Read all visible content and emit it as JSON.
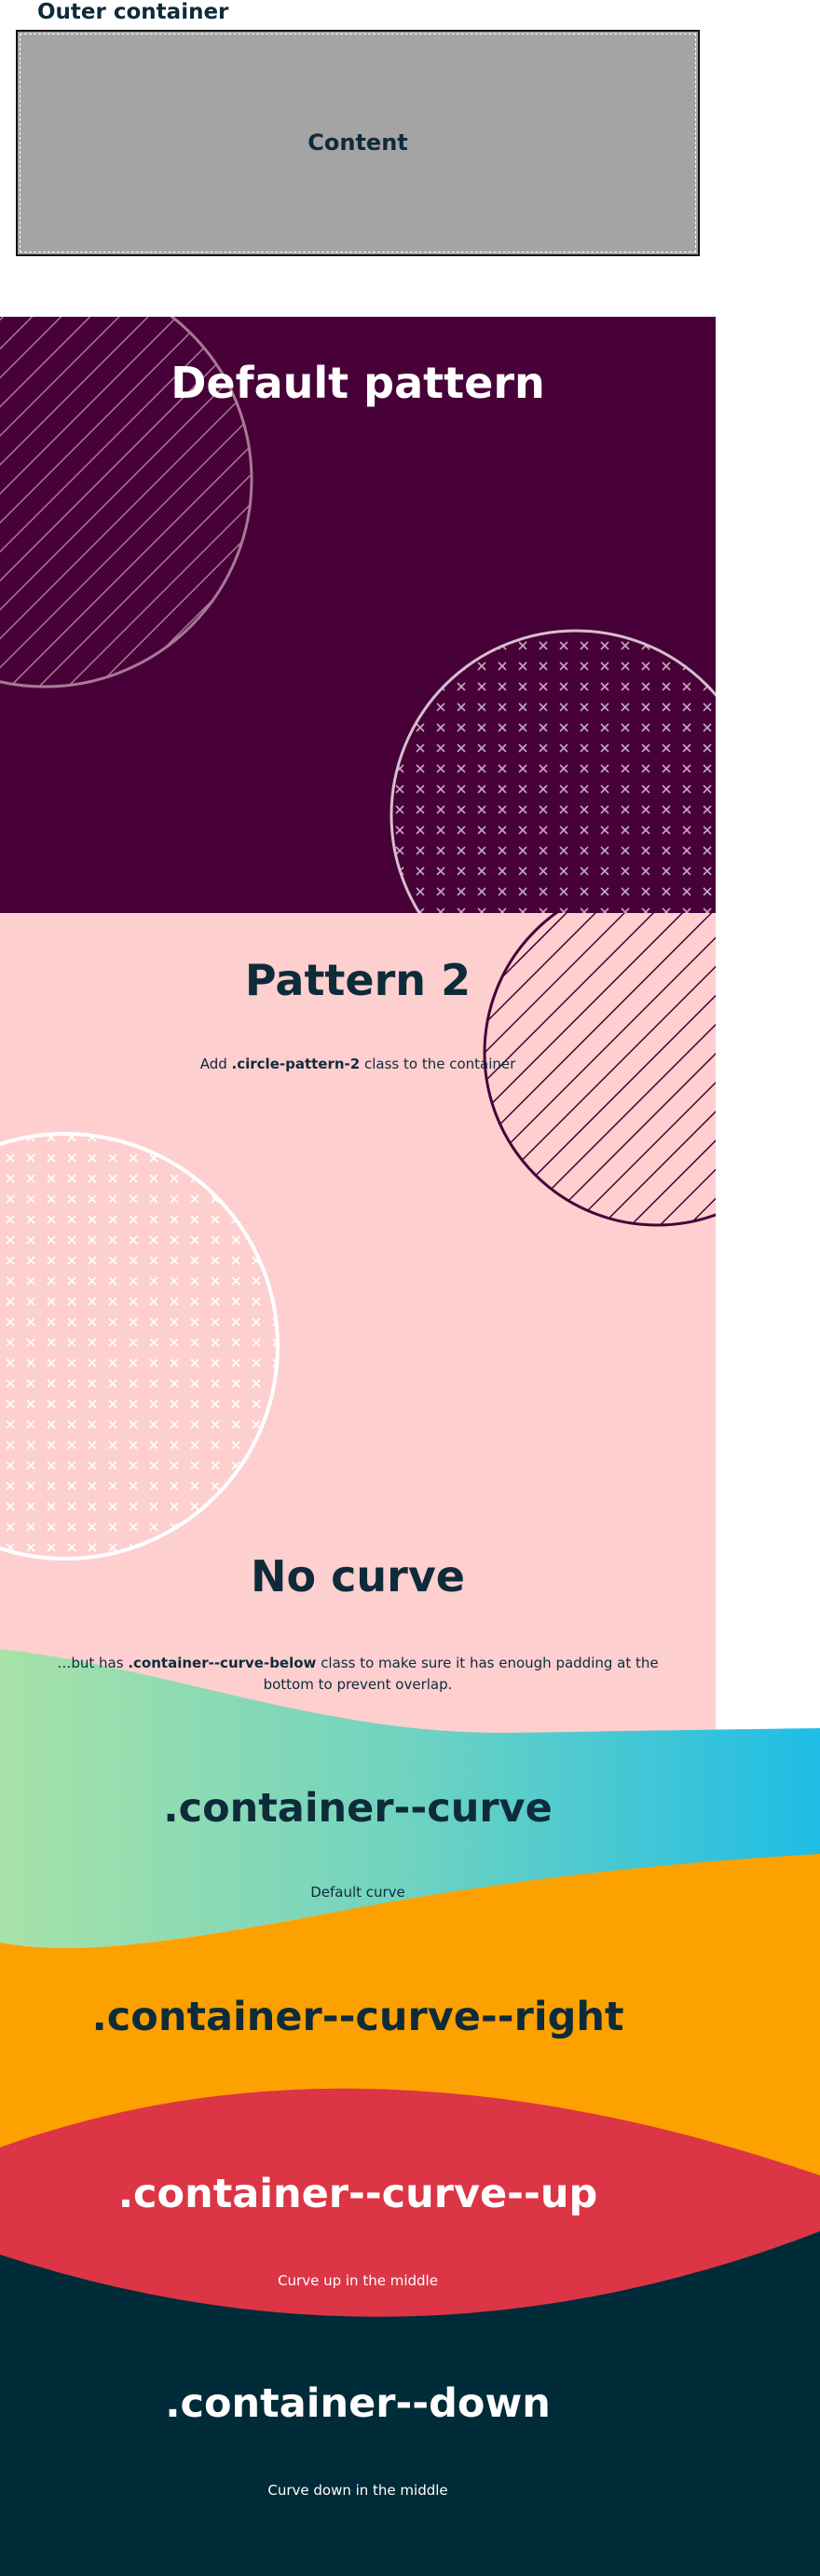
{
  "outer": {
    "title": "Outer container",
    "content": "Content"
  },
  "default_pattern": {
    "title": "Default pattern",
    "background": "#470038"
  },
  "pattern2": {
    "title": "Pattern 2",
    "desc_prefix": "Add ",
    "desc_bold": ".circle-pattern-2",
    "desc_suffix": " class to the container",
    "background": "#fdcfcf"
  },
  "no_curve": {
    "title": "No curve",
    "desc_line1_prefix": "…but has ",
    "desc_bold": ".container--curve-below",
    "desc_line1_suffix": " class to make sure it has enough padding at the",
    "desc_line2": "bottom to prevent overlap."
  },
  "curve": {
    "title": ".container--curve",
    "desc": "Default curve"
  },
  "curve_right": {
    "title": ".container--curve--right",
    "background": "#fca100"
  },
  "curve_up": {
    "title": ".container--curve--up",
    "desc": "Curve up in the middle",
    "background": "#dc3545"
  },
  "down": {
    "title": ".container--down",
    "desc": "Curve down in the middle",
    "background": "#002b38"
  }
}
